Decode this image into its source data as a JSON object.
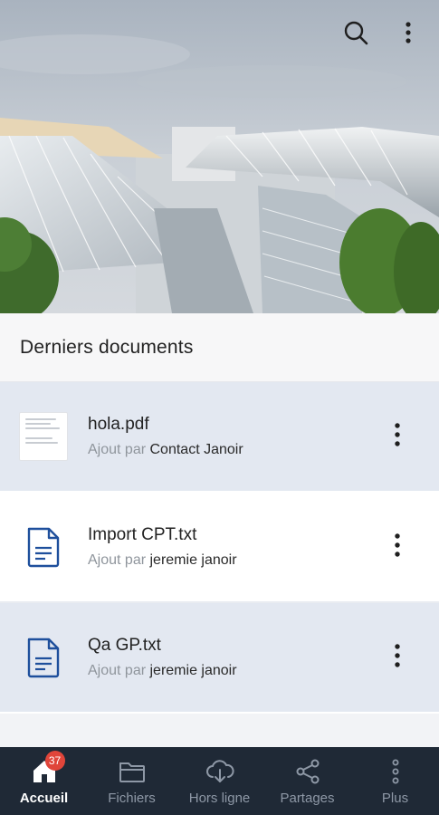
{
  "header": {
    "search_icon": "search-icon",
    "more_icon": "more-vertical-icon"
  },
  "section": {
    "title": "Derniers documents"
  },
  "documents": [
    {
      "name": "hola.pdf",
      "added_by_label": "Ajout par",
      "author": "Contact Janoir",
      "icon": "pdf-thumbnail"
    },
    {
      "name": "Import CPT.txt",
      "added_by_label": "Ajout par",
      "author": "jeremie janoir",
      "icon": "text-file-icon"
    },
    {
      "name": "Qa GP.txt",
      "added_by_label": "Ajout par",
      "author": "jeremie janoir",
      "icon": "text-file-icon"
    }
  ],
  "nav": {
    "items": [
      {
        "label": "Accueil",
        "icon": "home-icon",
        "badge": "37",
        "active": true
      },
      {
        "label": "Fichiers",
        "icon": "folder-icon"
      },
      {
        "label": "Hors ligne",
        "icon": "cloud-download-icon"
      },
      {
        "label": "Partages",
        "icon": "share-icon"
      },
      {
        "label": "Plus",
        "icon": "more-vertical-icon"
      }
    ]
  },
  "colors": {
    "nav_bg": "#1f2936",
    "alt_row": "#e3e8f1",
    "badge": "#e0453a",
    "file_icon": "#1e4f9c"
  }
}
